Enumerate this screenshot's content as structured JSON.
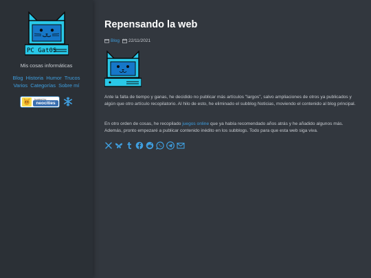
{
  "site": {
    "logo_text": "PC Gat0S",
    "tagline": "Mis cosas informáticas",
    "nav": [
      "Blog",
      "Historia",
      "Humor",
      "Trucos",
      "Varios",
      "Categorías",
      "Sobre mí"
    ],
    "badge_hosted": "hosted by",
    "badge_name": "neocities"
  },
  "post": {
    "title": "Repensando la web",
    "tag": "Blog",
    "date": "22/11/2021",
    "p1": "Ante la falta de tiempo y ganas, he decidido no publicar más artículos \"largos\", salvo ampliaciones de otros ya publicados y algún que otro artículo recopilatorio. Al hilo de esto, he eliminado el subblog Noticias, moviendo el contenido al blog principal.",
    "p2_before": "En otro orden de cosas, he recopilado ",
    "p2_link": "juegos online",
    "p2_after": " que ya había recomendado años atrás y he añadido algunos más. Además, pronto empezaré a publicar contenido inédito en los subblogs. Todo para que esta web siga viva."
  },
  "share_icons": [
    "x-icon",
    "bluesky-icon",
    "tumblr-icon",
    "facebook-icon",
    "reddit-icon",
    "whatsapp-icon",
    "telegram-icon",
    "email-icon"
  ],
  "colors": {
    "accent": "#3f9fe0",
    "cyan": "#29c8e8",
    "sidebar": "#2b3036",
    "main": "#32373e"
  }
}
